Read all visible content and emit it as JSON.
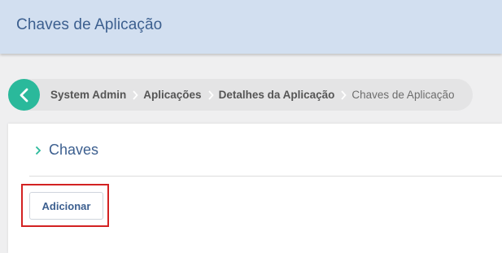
{
  "header": {
    "title": "Chaves de Aplicação"
  },
  "breadcrumb": {
    "items": [
      {
        "label": "System Admin"
      },
      {
        "label": "Aplicações"
      },
      {
        "label": "Detalhes da Aplicação"
      },
      {
        "label": "Chaves de Aplicação"
      }
    ]
  },
  "section": {
    "title": "Chaves"
  },
  "actions": {
    "add_label": "Adicionar"
  },
  "colors": {
    "header_bg": "#d2dff0",
    "title_blue": "#3c5f8f",
    "back_button": "#2ab99b",
    "highlight_red": "#d32222"
  },
  "icons": {
    "back": "chevron-left-icon",
    "separator": "chevron-right-icon",
    "section": "chevron-right-icon"
  }
}
